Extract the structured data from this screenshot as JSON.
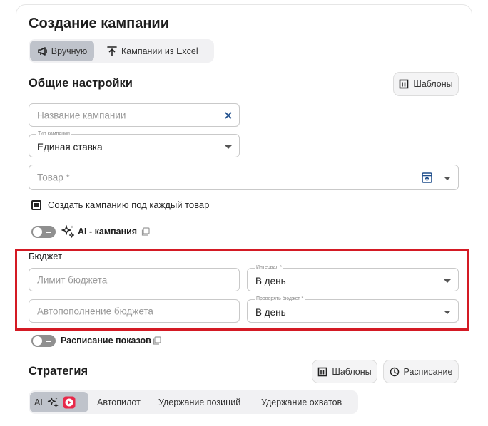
{
  "page": {
    "title": "Создание кампании"
  },
  "mode_switch": {
    "manual": "Вручную",
    "excel": "Кампании из Excel"
  },
  "general": {
    "title": "Общие настройки",
    "templates_button": "Шаблоны",
    "campaign_name": {
      "placeholder": "Название кампании",
      "value": ""
    },
    "campaign_type": {
      "label": "Тип кампании",
      "value": "Единая ставка"
    },
    "product": {
      "placeholder": "Товар *"
    },
    "per_product_checkbox": {
      "label": "Создать кампанию под каждый товар",
      "checked": true
    },
    "ai_campaign": {
      "label": "AI - кампания",
      "enabled": false
    }
  },
  "budget": {
    "title": "Бюджет",
    "limit": {
      "placeholder": "Лимит бюджета"
    },
    "interval": {
      "label": "Интервал *",
      "value": "В день"
    },
    "autofill": {
      "placeholder": "Автопополнение бюджета"
    },
    "check_budget": {
      "label": "Проверять бюджет *",
      "value": "В день"
    }
  },
  "schedule": {
    "label": "Расписание показов",
    "enabled": false
  },
  "strategy": {
    "title": "Стратегия",
    "templates_button": "Шаблоны",
    "schedule_button": "Расписание",
    "tabs": [
      {
        "label": "AI"
      },
      {
        "label": "Автопилот"
      },
      {
        "label": "Удержание позиций"
      },
      {
        "label": "Удержание охватов"
      }
    ]
  },
  "colors": {
    "highlight": "#d41a24",
    "accent": "#1f4e8c",
    "active_tab": "#bfc3cb"
  }
}
